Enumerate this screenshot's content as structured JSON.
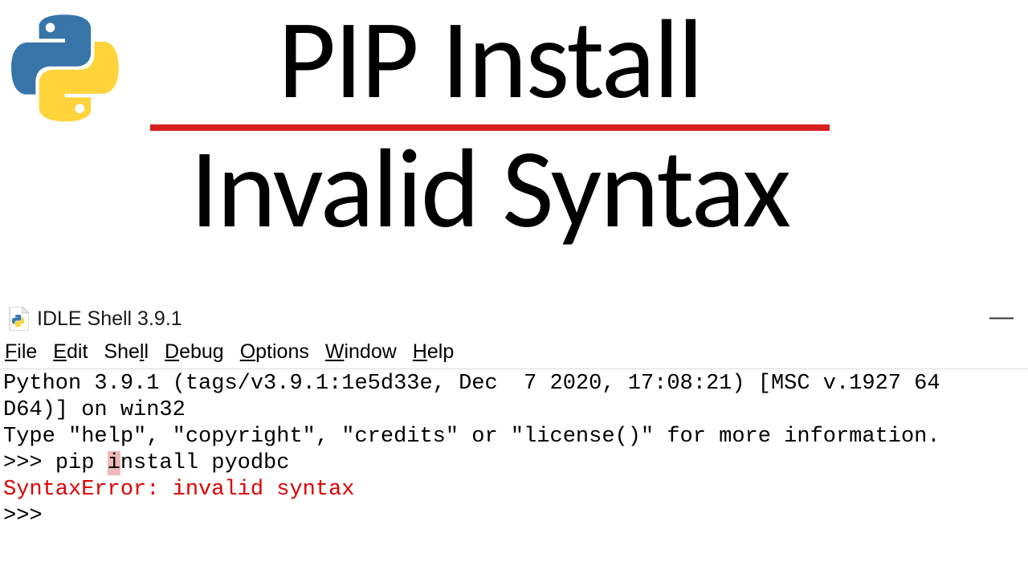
{
  "header": {
    "title_line1": "PIP Install",
    "title_line2": "Invalid Syntax"
  },
  "idle": {
    "window_title": "IDLE Shell 3.9.1",
    "menu": {
      "file": "File",
      "edit": "Edit",
      "shell": "Shell",
      "debug": "Debug",
      "options": "Options",
      "window": "Window",
      "help": "Help"
    },
    "banner_line1": "Python 3.9.1 (tags/v3.9.1:1e5d33e, Dec  7 2020, 17:08:21) [MSC v.1927 64",
    "banner_line2": "D64)] on win32",
    "banner_line3": "Type \"help\", \"copyright\", \"credits\" or \"license()\" for more information.",
    "prompt": ">>> ",
    "cmd_prefix": "pip ",
    "cmd_highlight": "i",
    "cmd_suffix": "nstall pyodbc",
    "error": "SyntaxError: invalid syntax",
    "prompt2": ">>> "
  }
}
